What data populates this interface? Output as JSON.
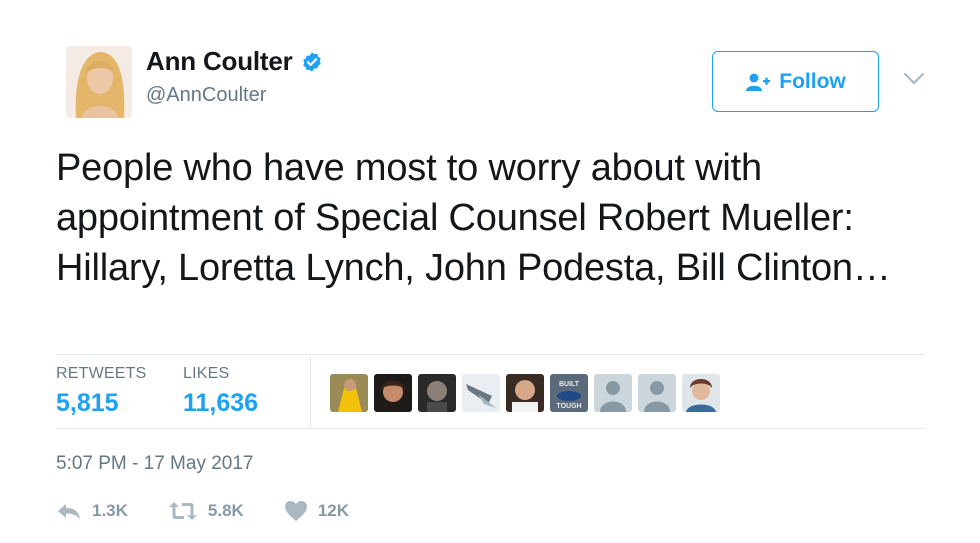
{
  "author": {
    "name": "Ann Coulter",
    "handle": "@AnnCoulter",
    "verified": true
  },
  "follow_button": {
    "label": "Follow"
  },
  "tweet": {
    "text": "People who have most to worry about with appointment of Special Counsel Robert Mueller: Hillary, Loretta Lynch, John Podesta, Bill Clinton…",
    "timestamp": "5:07 PM - 17 May 2017"
  },
  "stats": {
    "retweets_label": "RETWEETS",
    "retweets_count": "5,815",
    "likes_label": "LIKES",
    "likes_count": "11,636"
  },
  "likers": [
    {
      "icon": "liker-avatar-1"
    },
    {
      "icon": "liker-avatar-2"
    },
    {
      "icon": "liker-avatar-3"
    },
    {
      "icon": "liker-avatar-4"
    },
    {
      "icon": "liker-avatar-5"
    },
    {
      "icon": "liker-avatar-6",
      "text": "BUILT TOUGH"
    },
    {
      "icon": "default-avatar"
    },
    {
      "icon": "default-avatar"
    },
    {
      "icon": "liker-avatar-9"
    }
  ],
  "actions": {
    "reply_count": "1.3K",
    "retweet_count": "5.8K",
    "like_count": "12K"
  },
  "colors": {
    "accent": "#1da1f2",
    "text": "#14171a",
    "muted": "#657786",
    "action": "#8899a6",
    "divider": "#e1e8ed"
  }
}
